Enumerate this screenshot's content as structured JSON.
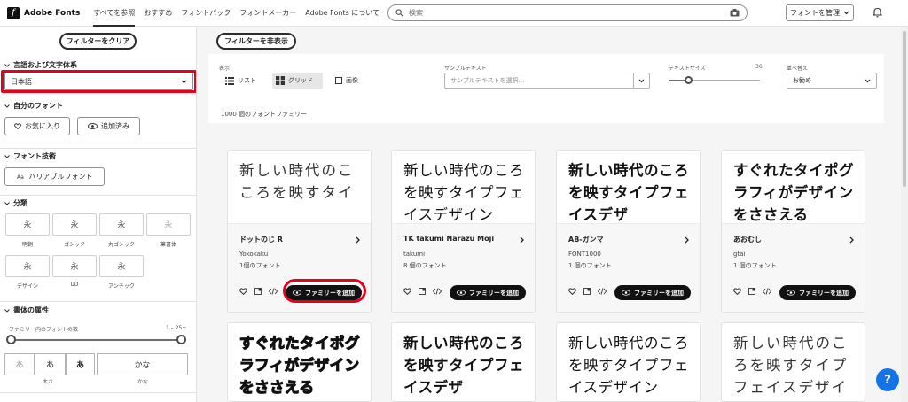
{
  "nav": {
    "brand": "Adobe Fonts",
    "links": [
      "すべてを参照",
      "おすすめ",
      "フォントパック",
      "フォントメーカー",
      "Adobe Fonts について"
    ],
    "search_placeholder": "検索",
    "manage_label": "フォントを管理"
  },
  "sidebar": {
    "clear_filters": "フィルターをクリア",
    "lang_title": "言語および文字体系",
    "lang_value": "日本語",
    "myfonts_title": "自分のフォント",
    "favorites": "お気に入り",
    "added": "追加済み",
    "tech_title": "フォント技術",
    "variable": "バリアブルフォント",
    "class_title": "分類",
    "class_sample": "永",
    "classes": [
      "明朝",
      "ゴシック",
      "丸ゴシック",
      "筆書体",
      "デザイン",
      "UD",
      "アンチック"
    ],
    "props_title": "書体の属性",
    "count_label": "ファミリー内のフォントの数",
    "count_range": "1 – 25+",
    "weight_samples": [
      "あ",
      "あ",
      "あ"
    ],
    "kana_sample": "かな",
    "weight_label": "太さ",
    "kana_label": "かな"
  },
  "main": {
    "hide_filters": "フィルターを非表示",
    "view_label": "表示",
    "view_list": "リスト",
    "view_grid": "グリッド",
    "view_image": "画像",
    "sample_label": "サンプルテキスト",
    "sample_placeholder": "サンプルテキストを選択...",
    "size_label": "テキストサイズ",
    "size_value": "36",
    "size_fraction": 0.22,
    "sort_label": "並べ替え",
    "sort_value": "お勧め",
    "count_text": "1000 個のフォントファミリー",
    "add_label": "ファミリーを追加"
  },
  "cards": [
    {
      "preview": "新しい時代のこころを映すタイ",
      "name": "ドットのじ R",
      "foundry": "Yokokaku",
      "count": "1個のフォント"
    },
    {
      "preview": "新しい時代のころを映すタイプフェイスデザイン",
      "name": "TK takumi Narazu Moji",
      "foundry": "takumi",
      "count": "8 個のフォント"
    },
    {
      "preview": "新しい時代のころを映すタイプフェイスデザ",
      "name": "AB-ガンマ",
      "foundry": "FONT1000",
      "count": "1 個のフォント"
    },
    {
      "preview": "すぐれたタイポグラフィがデザインをささえる",
      "name": "あおむし",
      "foundry": "gtai",
      "count": "1 個のフォント"
    },
    {
      "preview": "すぐれたタイポグラフィがデザインをささえる"
    },
    {
      "preview": "新しい時代のころを映すタイプフェイスデザ"
    },
    {
      "preview": "新しい時代のころを映すタイプフェイスデザイン"
    },
    {
      "preview": "新しい時代のころを映すタイプフェイスデザイン"
    }
  ],
  "help_label": "?"
}
